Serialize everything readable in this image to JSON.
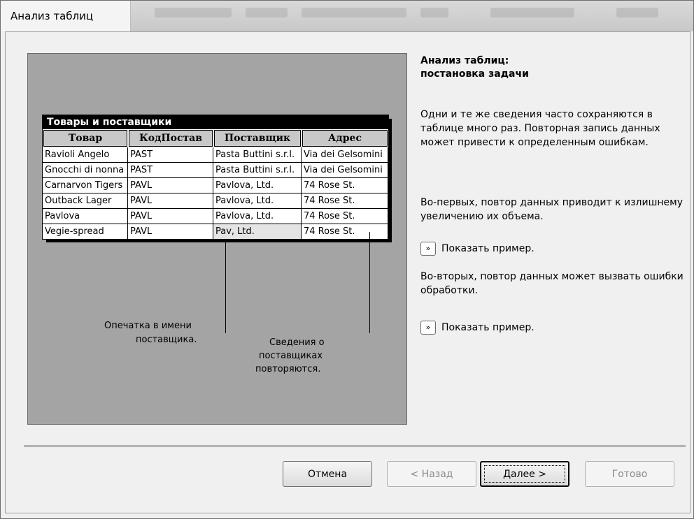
{
  "window": {
    "title": "Анализ таблиц"
  },
  "illustration": {
    "table_title": "Товары и поставщики",
    "headers": [
      "Товар",
      "КодПостав",
      "Поставщик",
      "Адрес"
    ],
    "rows": [
      [
        "Ravioli Angelo",
        "PAST",
        "Pasta Buttini s.r.l.",
        "Via dei Gelsomini"
      ],
      [
        "Gnocchi di nonna",
        "PAST",
        "Pasta Buttini s.r.l.",
        "Via dei Gelsomini"
      ],
      [
        "Carnarvon Tigers",
        "PAVL",
        "Pavlova, Ltd.",
        "74 Rose St."
      ],
      [
        "Outback Lager",
        "PAVL",
        "Pavlova, Ltd.",
        "74 Rose St."
      ],
      [
        "Pavlova",
        "PAVL",
        "Pavlova, Ltd.",
        "74 Rose St."
      ],
      [
        "Vegie-spread",
        "PAVL",
        "Pav, Ltd.",
        "74 Rose St."
      ]
    ],
    "callout_typo_1": "Опечатка в имени",
    "callout_typo_2": "поставщика.",
    "callout_repeat_1": "Сведения о",
    "callout_repeat_2": "поставщиках",
    "callout_repeat_3": "повторяются."
  },
  "info": {
    "title_line1": "Анализ таблиц:",
    "title_line2": "постановка задачи",
    "para1": "Одни и те же сведения часто сохраняются в  таблице много раз. Повторная запись данных может привести к определенным ошибкам.",
    "para2": "Во-первых, повтор данных приводит к излишнему увеличению их объема.",
    "example1_label": "Показать пример.",
    "para3": "Во-вторых, повтор данных может вызвать ошибки обработки.",
    "example2_label": "Показать пример.",
    "example_icon": "double-chevron-right-icon",
    "example_glyph": "»"
  },
  "buttons": {
    "cancel": "Отмена",
    "back": "< Назад",
    "next": "Далее >",
    "finish": "Готово"
  }
}
